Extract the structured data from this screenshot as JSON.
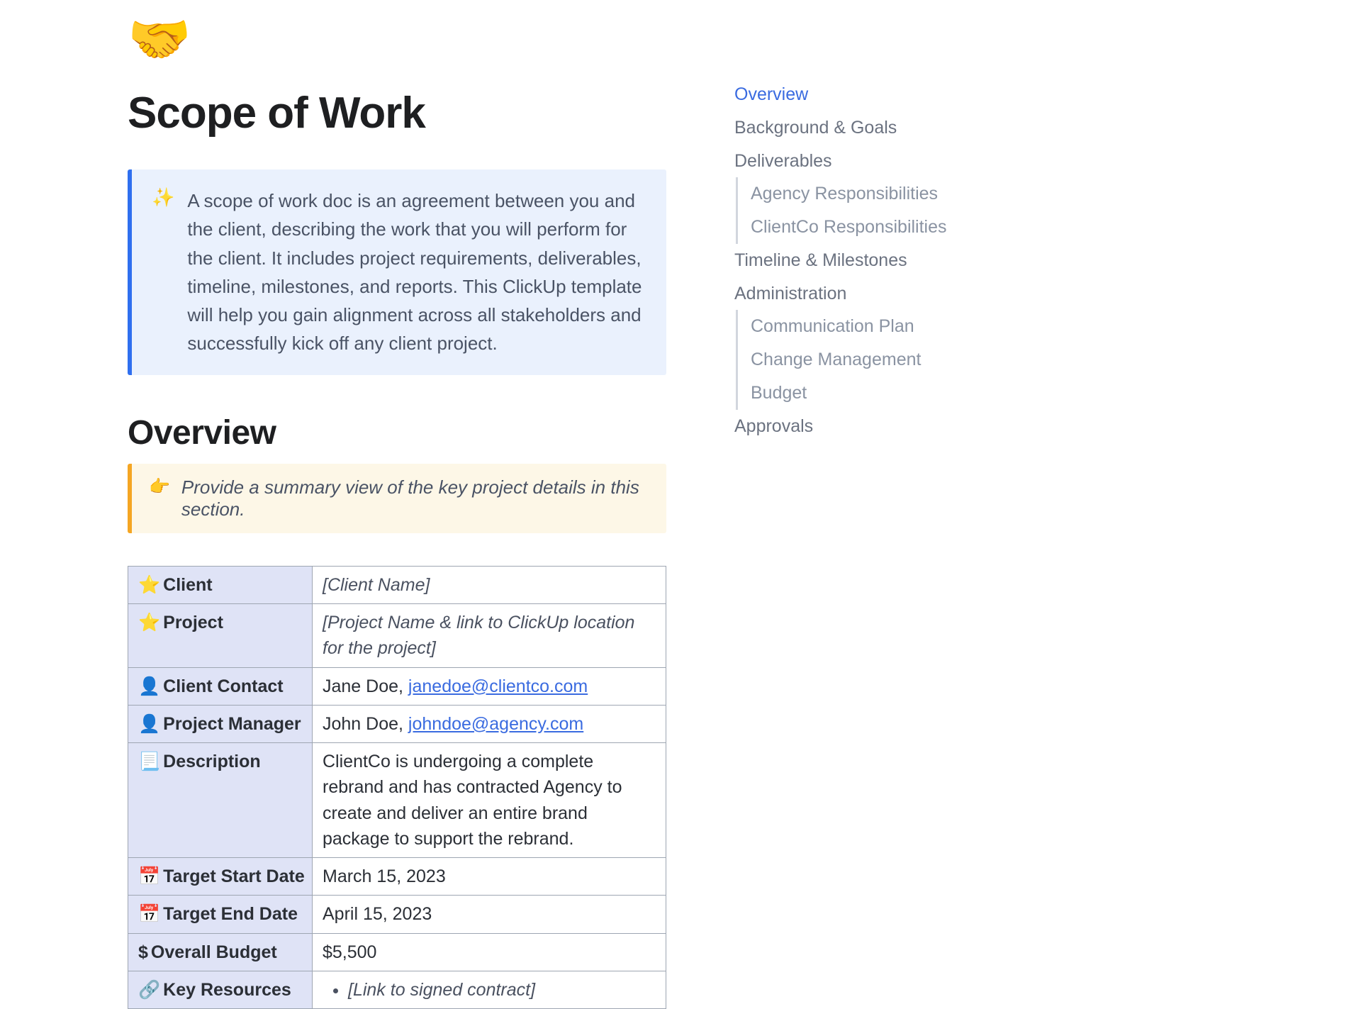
{
  "header": {
    "emoji": "🤝",
    "title": "Scope of Work"
  },
  "introCallout": {
    "emoji": "✨",
    "text": "A scope of work doc is an agreement between you and the client, describing the work that you will perform for the client. It includes project requirements, deliverables, timeline, milestones, and reports. This ClickUp template will help you gain alignment across all stakeholders and successfully kick off any client project."
  },
  "overview": {
    "heading": "Overview",
    "callout": {
      "emoji": "👉",
      "text": "Provide a summary view of the key project details in this section."
    },
    "rows": {
      "client": {
        "icon": "⭐",
        "label": "Client",
        "value": "[Client Name]"
      },
      "project": {
        "icon": "⭐",
        "label": "Project",
        "value": "[Project Name & link to ClickUp location for the project]"
      },
      "clientContact": {
        "icon": "👤",
        "label": "Client Contact",
        "person": "Jane Doe, ",
        "email": "janedoe@clientco.com"
      },
      "pm": {
        "icon": "👤",
        "label": "Project Manager",
        "person": "John Doe, ",
        "email": "johndoe@agency.com"
      },
      "description": {
        "icon": "📃",
        "label": "Description",
        "value": "ClientCo is undergoing a complete rebrand and has contracted Agency to create and deliver an entire brand package to support the rebrand."
      },
      "startDate": {
        "icon": "📅",
        "label": "Target Start Date",
        "value": "March 15, 2023"
      },
      "endDate": {
        "icon": "📅",
        "label": "Target End Date",
        "value": "April 15, 2023"
      },
      "budget": {
        "icon": "$",
        "label": "Overall Budget",
        "value": "$5,500"
      },
      "resources": {
        "icon": "🔗",
        "label": "Key Resources",
        "item": "[Link to signed contract]"
      }
    }
  },
  "toc": {
    "items": [
      {
        "label": "Overview",
        "active": true
      },
      {
        "label": "Background & Goals"
      },
      {
        "label": "Deliverables",
        "children": [
          "Agency Responsibilities",
          "ClientCo Responsibilities"
        ]
      },
      {
        "label": "Timeline & Milestones"
      },
      {
        "label": "Administration",
        "children": [
          "Communication Plan",
          "Change Management",
          "Budget"
        ]
      },
      {
        "label": "Approvals"
      }
    ]
  }
}
